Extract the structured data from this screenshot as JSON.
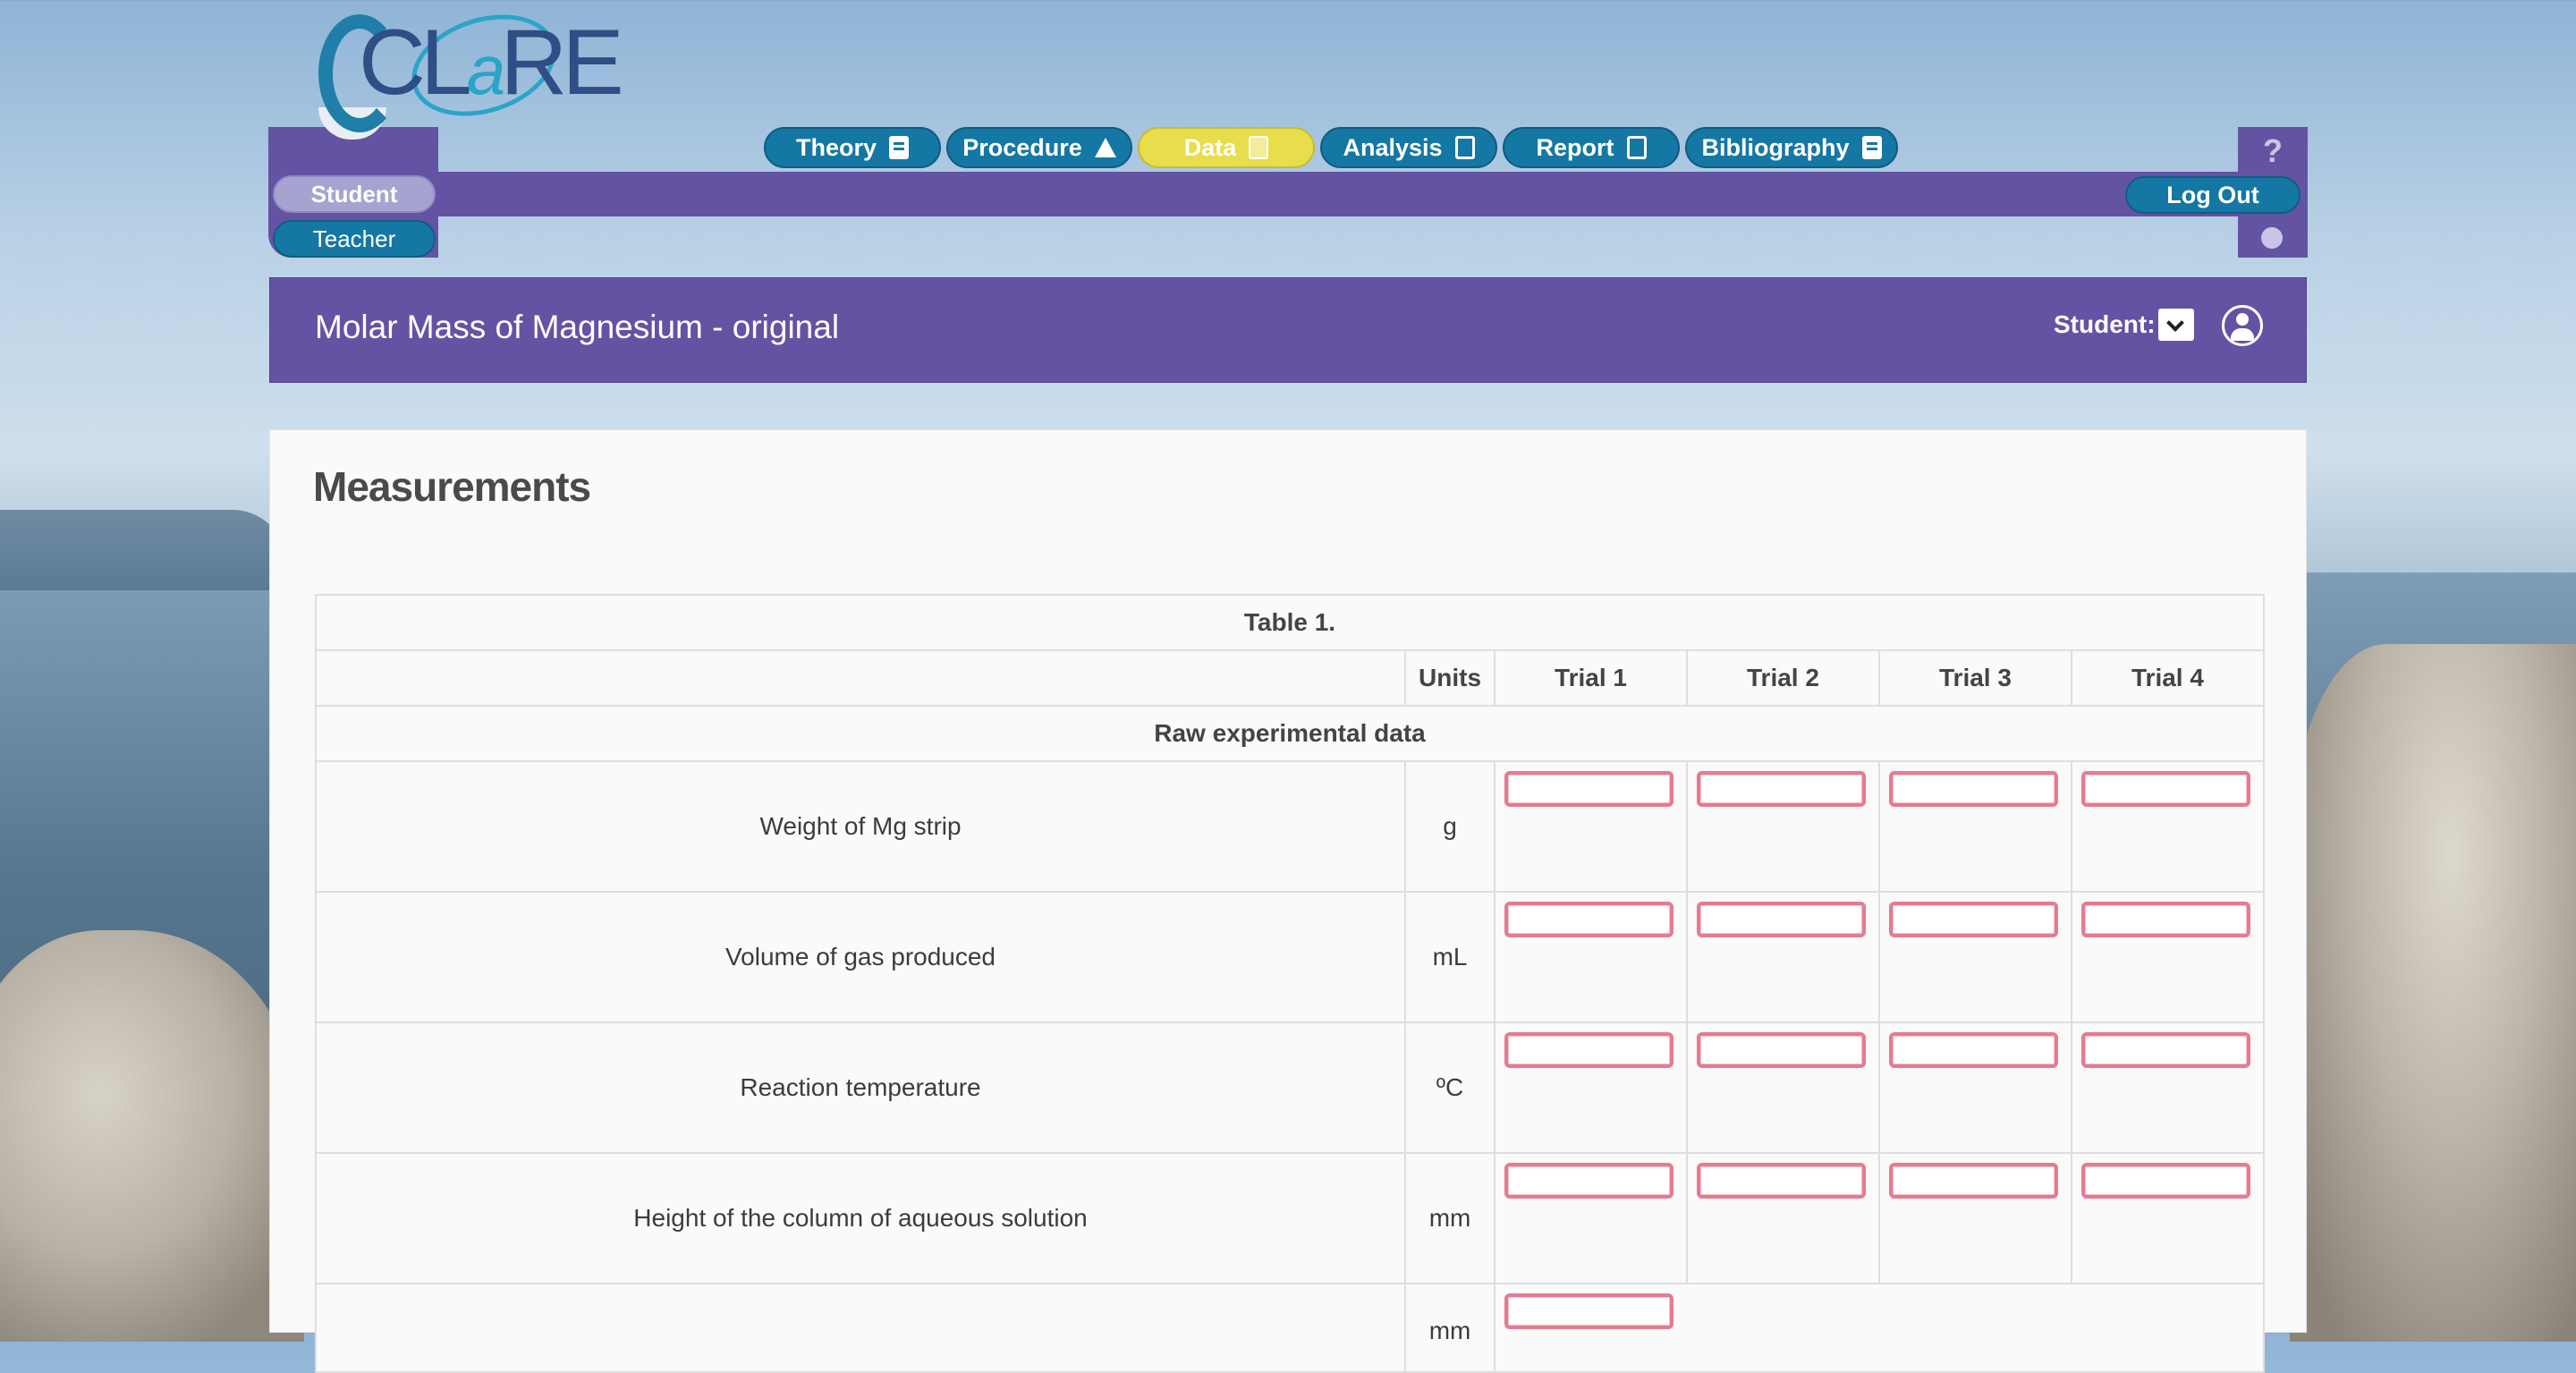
{
  "nav": {
    "tabs": [
      {
        "label": "Theory",
        "icon": "book-icon"
      },
      {
        "label": "Procedure",
        "icon": "flask-icon"
      },
      {
        "label": "Data",
        "icon": "calculator-icon",
        "active": true
      },
      {
        "label": "Analysis",
        "icon": "document-icon"
      },
      {
        "label": "Report",
        "icon": "clipboard-icon"
      },
      {
        "label": "Bibliography",
        "icon": "book-icon"
      }
    ],
    "roles": {
      "student": "Student",
      "teacher": "Teacher"
    },
    "logout": "Log Out",
    "help": "?"
  },
  "header": {
    "title": "Molar Mass of Magnesium - original",
    "student_label": "Student:"
  },
  "main": {
    "section_title": "Measurements",
    "table": {
      "caption": "Table 1.",
      "columns": [
        "",
        "Units",
        "Trial 1",
        "Trial 2",
        "Trial 3",
        "Trial 4"
      ],
      "group_label": "Raw experimental data",
      "rows": [
        {
          "label": "Weight of Mg strip",
          "unit": "g"
        },
        {
          "label": "Volume of gas produced",
          "unit": "mL"
        },
        {
          "label": "Reaction temperature",
          "unit": "ºC"
        },
        {
          "label": "Height of the column of aqueous solution",
          "unit": "mm"
        }
      ],
      "partial_row_unit": "mm"
    }
  },
  "colors": {
    "purple": "#6453a3",
    "tab_blue": "#1577a3",
    "active_yellow": "#e8dd4a",
    "input_border": "#e87a8e"
  }
}
